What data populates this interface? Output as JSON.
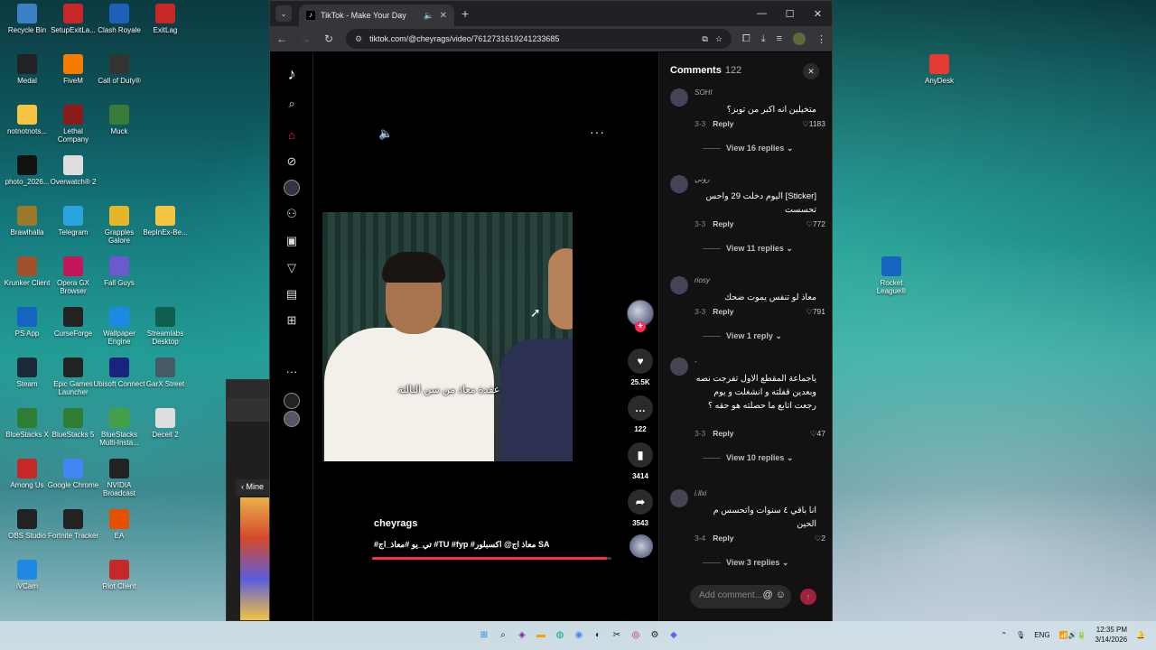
{
  "desktop": {
    "icons_left": [
      {
        "label": "Recycle Bin",
        "icon": "recycle-bin-icon",
        "color": "#3b82c4"
      },
      {
        "label": "SetupExitLa...",
        "icon": "exitlag-setup-icon",
        "color": "#c62828"
      },
      {
        "label": "Clash Royale",
        "icon": "clash-royale-icon",
        "color": "#1e5fb8"
      },
      {
        "label": "ExitLag",
        "icon": "exitlag-icon",
        "color": "#c62828"
      },
      {
        "label": "Medal",
        "icon": "medal-icon",
        "color": "#222222"
      },
      {
        "label": "FiveM",
        "icon": "fivem-icon",
        "color": "#f57c00"
      },
      {
        "label": "Call of Duty®",
        "icon": "call-of-duty-icon",
        "color": "#333333"
      },
      {
        "label": "notnotnots...",
        "icon": "folder-icon",
        "color": "#f4c542"
      },
      {
        "label": "Lethal Company",
        "icon": "lethal-company-icon",
        "color": "#8b1a1a"
      },
      {
        "label": "Muck",
        "icon": "muck-icon",
        "color": "#3a7a3a"
      },
      {
        "label": "photo_2026...",
        "icon": "photo-icon",
        "color": "#111111"
      },
      {
        "label": "Overwatch® 2",
        "icon": "overwatch-icon",
        "color": "#dddddd"
      },
      {
        "label": "Brawlhalla",
        "icon": "brawlhalla-icon",
        "color": "#9a7a2a"
      },
      {
        "label": "Telegram",
        "icon": "telegram-icon",
        "color": "#2aa3df"
      },
      {
        "label": "Grapples Galore",
        "icon": "grapples-galore-icon",
        "color": "#e6b62a"
      },
      {
        "label": "BepInEx-Be...",
        "icon": "folder-icon",
        "color": "#f4c542"
      },
      {
        "label": "Krunker Client",
        "icon": "krunker-icon",
        "color": "#a0522d"
      },
      {
        "label": "Opera GX Browser",
        "icon": "opera-gx-icon",
        "color": "#c2185b"
      },
      {
        "label": "Fall Guys",
        "icon": "fall-guys-icon",
        "color": "#6a5acd"
      },
      {
        "label": "PS App",
        "icon": "ps-app-icon",
        "color": "#1565c0"
      },
      {
        "label": "CurseForge",
        "icon": "curseforge-icon",
        "color": "#222222"
      },
      {
        "label": "Wallpaper Engine",
        "icon": "wallpaper-engine-icon",
        "color": "#1e88e5"
      },
      {
        "label": "Streamlabs Desktop",
        "icon": "streamlabs-icon",
        "color": "#0f5f4f"
      },
      {
        "label": "Steam",
        "icon": "steam-icon",
        "color": "#1b2838"
      },
      {
        "label": "Epic Games Launcher",
        "icon": "epic-games-icon",
        "color": "#222222"
      },
      {
        "label": "Ubisoft Connect",
        "icon": "ubisoft-icon",
        "color": "#1a237e"
      },
      {
        "label": "GarX Street",
        "icon": "garx-street-icon",
        "color": "#455a64"
      },
      {
        "label": "BlueStacks X",
        "icon": "bluestacks-x-icon",
        "color": "#2e7d32"
      },
      {
        "label": "BlueStacks 5",
        "icon": "bluestacks-5-icon",
        "color": "#2e7d32"
      },
      {
        "label": "BlueStacks Multi-Insta...",
        "icon": "bluestacks-multi-icon",
        "color": "#43a047"
      },
      {
        "label": "Deceit 2",
        "icon": "deceit-icon",
        "color": "#dddddd"
      },
      {
        "label": "Among Us",
        "icon": "among-us-icon",
        "color": "#c62828"
      },
      {
        "label": "Google Chrome",
        "icon": "chrome-icon",
        "color": "#4285f4"
      },
      {
        "label": "NVIDIA Broadcast",
        "icon": "nvidia-broadcast-icon",
        "color": "#222222"
      },
      {
        "label": "OBS Studio",
        "icon": "obs-icon",
        "color": "#222222"
      },
      {
        "label": "Fortnite Tracker",
        "icon": "fortnite-tracker-icon",
        "color": "#222222"
      },
      {
        "label": "EA",
        "icon": "ea-icon",
        "color": "#e65100"
      },
      {
        "label": "iVCam",
        "icon": "ivcam-icon",
        "color": "#1e88e5"
      },
      {
        "label": "Riot Client",
        "icon": "riot-client-icon",
        "color": "#c62828"
      }
    ],
    "icons_right": [
      {
        "label": "AnyDesk",
        "icon": "anydesk-icon",
        "color": "#e53935"
      },
      {
        "label": "Rocket League®",
        "icon": "rocket-league-icon",
        "color": "#1565c0"
      }
    ]
  },
  "back_window": {
    "item_label": "Mine"
  },
  "browser": {
    "tab_title": "TikTok - Make Your Day",
    "url": "tiktok.com/@cheyrags/video/7612731619241233685",
    "new_tab": "+",
    "window_controls": [
      "—",
      "☐",
      "✕"
    ]
  },
  "tiktok": {
    "video": {
      "caption_overlay": "عقدة معاذ من سن الثالثة",
      "author": "cheyrags",
      "description": "#تي_يو #معاذ_اج #TU #fyp #معاذ اج@ اكسبلور SA",
      "progress": 0.98
    },
    "actions": {
      "likes": "25.5K",
      "comments": "122",
      "saves": "3414",
      "shares": "3543"
    },
    "comments": {
      "title": "Comments",
      "count": "122",
      "input_placeholder": "Add comment...",
      "items": [
        {
          "user": "SOHI",
          "text": "متخيلين انه اكبر من توبز؟",
          "date": "3-3",
          "reply": "Reply",
          "likes": "1183",
          "replies": "View 16 replies"
        },
        {
          "user": "روني",
          "text": "[Sticker] اليوم دخلت 29 واحس تحسست",
          "date": "3-3",
          "reply": "Reply",
          "likes": "772",
          "replies": "View 11 replies"
        },
        {
          "user": "riosy",
          "text": "معاذ لو تنفس يموت ضحك",
          "date": "3-3",
          "reply": "Reply",
          "likes": "791",
          "replies": "View 1 reply"
        },
        {
          "user": "-",
          "text": "ياجماعة المقطع الاول تفرجت نصه وبعدين قفلته و انشغلت و يوم رجعت اتابع ما حصلته هو حقه ؟",
          "date": "3-3",
          "reply": "Reply",
          "likes": "47",
          "replies": "View 10 replies"
        },
        {
          "user": "i.llxi",
          "text": "انا باقي ٤ سنوات واتحسس م الحين",
          "date": "3-4",
          "reply": "Reply",
          "likes": "2",
          "replies": "View 3 replies"
        }
      ]
    }
  },
  "taskbar": {
    "language": "ENG",
    "time": "12:35 PM",
    "date": "3/14/2026"
  }
}
